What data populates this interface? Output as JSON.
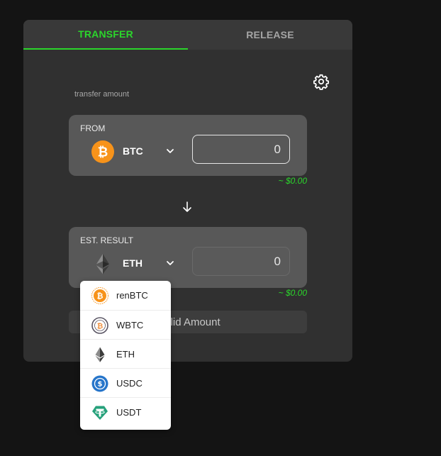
{
  "tabs": {
    "transfer": "TRANSFER",
    "release": "RELEASE"
  },
  "hint": "transfer amount",
  "from": {
    "label": "FROM",
    "symbol": "BTC",
    "amount": "0",
    "usd": "~ $0.00"
  },
  "to": {
    "label": "EST. RESULT",
    "symbol": "ETH",
    "amount": "0",
    "usd": "~ $0.00"
  },
  "submit_label": "Valid Amount",
  "dropdown": [
    {
      "label": "renBTC",
      "icon": "renbtc-icon"
    },
    {
      "label": "WBTC",
      "icon": "wbtc-icon"
    },
    {
      "label": "ETH",
      "icon": "eth-icon"
    },
    {
      "label": "USDC",
      "icon": "usdc-icon"
    },
    {
      "label": "USDT",
      "icon": "usdt-icon"
    }
  ],
  "colors": {
    "accent": "#2bd62b",
    "btc": "#f7931a",
    "usdc": "#2775ca",
    "usdt": "#26a17b"
  }
}
